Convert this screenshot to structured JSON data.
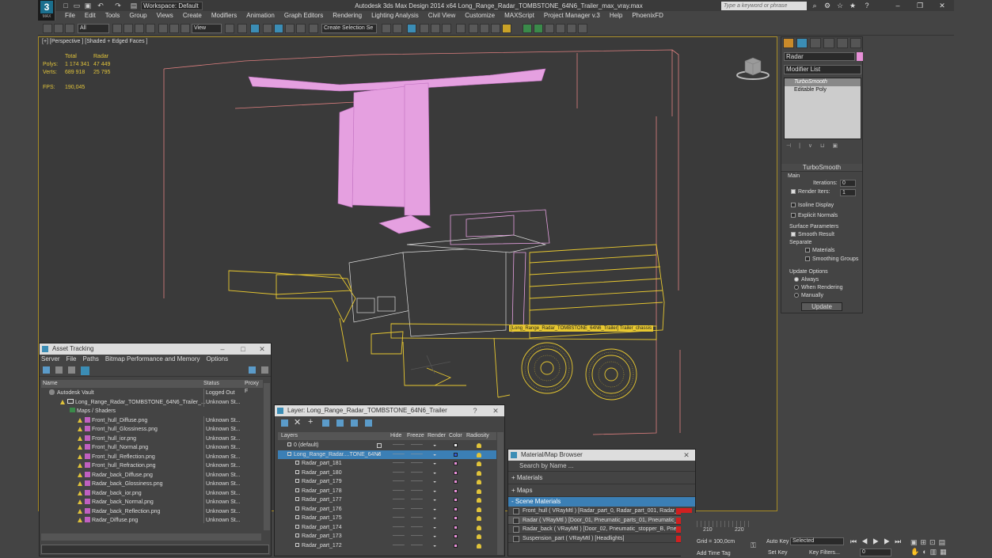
{
  "app": {
    "logo_letter": "3",
    "logo_sub": "MAX",
    "workspace": "Workspace: Default",
    "title": "Autodesk 3ds Max Design 2014 x64     Long_Range_Radar_TOMBSTONE_64N6_Trailer_max_vray.max",
    "search_placeholder": "Type a keyword or phrase"
  },
  "menus": [
    "File",
    "Edit",
    "Tools",
    "Group",
    "Views",
    "Create",
    "Modifiers",
    "Animation",
    "Graph Editors",
    "Rendering",
    "Lighting Analysis",
    "Civil View",
    "Customize",
    "MAXScript",
    "Project Manager v.3",
    "Help",
    "PhoenixFD"
  ],
  "toolbar": {
    "selection_filter": "All",
    "ref_coord": "View",
    "named_sel": "Create Selection Se"
  },
  "viewport": {
    "label": "[+] [Perspective ] [Shaded + Edged Faces ]",
    "stats": {
      "col1": "Total",
      "col2": "Radar",
      "polys_label": "Polys:",
      "polys_total": "1 174 341",
      "polys_radar": "47 449",
      "verts_label": "Verts:",
      "verts_total": "689 918",
      "verts_radar": "25 795",
      "fps_label": "FPS:",
      "fps_value": "190,045"
    },
    "tooltip": "[Long_Range_Radar_TOMBSTONE_64N6_Trailer] Trailer_chassis"
  },
  "command_panel": {
    "object_name": "Radar",
    "object_color": "#e890d8",
    "modifier_list": "Modifier List",
    "stack": [
      "TurboSmooth",
      "Editable Poly"
    ],
    "turbosmooth": {
      "title": "TurboSmooth",
      "main": "Main",
      "iterations_label": "Iterations:",
      "iterations": "0",
      "render_iters_label": "Render Iters:",
      "render_iters": "1",
      "isoline": "Isoline Display",
      "explicit": "Explicit Normals",
      "surface": "Surface Parameters",
      "smooth_result": "Smooth Result",
      "separate": "Separate",
      "materials": "Materials",
      "smoothing_groups": "Smoothing Groups",
      "update_options": "Update Options",
      "always": "Always",
      "when_rendering": "When Rendering",
      "manually": "Manually",
      "update_button": "Update"
    }
  },
  "asset_tracking": {
    "title": "Asset Tracking",
    "menus": [
      "Server",
      "File",
      "Paths",
      "Bitmap Performance and Memory",
      "Options"
    ],
    "columns": [
      "Name",
      "Status",
      "Proxy F"
    ],
    "rows": [
      {
        "name": "Autodesk Vault",
        "status": "Logged Out",
        "indent": 0
      },
      {
        "name": "Long_Range_Radar_TOMBSTONE_64N6_Trailer_...",
        "status": "Unknown St...",
        "indent": 1
      },
      {
        "name": "Maps / Shaders",
        "status": "",
        "indent": 2
      },
      {
        "name": "Front_hull_Diffuse.png",
        "status": "Unknown St...",
        "indent": 3
      },
      {
        "name": "Front_hull_Glossiness.png",
        "status": "Unknown St...",
        "indent": 3
      },
      {
        "name": "Front_hull_ior.png",
        "status": "Unknown St...",
        "indent": 3
      },
      {
        "name": "Front_hull_Normal.png",
        "status": "Unknown St...",
        "indent": 3
      },
      {
        "name": "Front_hull_Reflection.png",
        "status": "Unknown St...",
        "indent": 3
      },
      {
        "name": "Front_hull_Refraction.png",
        "status": "Unknown St...",
        "indent": 3
      },
      {
        "name": "Radar_back_Diffuse.png",
        "status": "Unknown St...",
        "indent": 3
      },
      {
        "name": "Radar_back_Glossiness.png",
        "status": "Unknown St...",
        "indent": 3
      },
      {
        "name": "Radar_back_ior.png",
        "status": "Unknown St...",
        "indent": 3
      },
      {
        "name": "Radar_back_Normal.png",
        "status": "Unknown St...",
        "indent": 3
      },
      {
        "name": "Radar_back_Reflection.png",
        "status": "Unknown St...",
        "indent": 3
      },
      {
        "name": "Radar_Diffuse.png",
        "status": "Unknown St...",
        "indent": 3
      }
    ]
  },
  "layers": {
    "title": "Layer: Long_Range_Radar_TOMBSTONE_64N6_Trailer",
    "columns": [
      "Layers",
      "Hide",
      "Freeze",
      "Render",
      "Color",
      "Radiosity"
    ],
    "rows": [
      "0 (default)",
      "Long_Range_Radar....TONE_64N6",
      "Radar_part_181",
      "Radar_part_180",
      "Radar_part_179",
      "Radar_part_178",
      "Radar_part_177",
      "Radar_part_176",
      "Radar_part_175",
      "Radar_part_174",
      "Radar_part_173",
      "Radar_part_172"
    ]
  },
  "material_browser": {
    "title": "Material/Map Browser",
    "search_placeholder": "Search by Name ...",
    "groups": [
      "+ Materials",
      "+ Maps",
      "- Scene Materials"
    ],
    "materials": [
      "Front_hull ( VRayMtl ) [Radar_part_0, Radar_part_001, Radar_p...",
      "Radar ( VRayMtl ) [Door_01, Pneumatic_parts_01, Pneumatic_p...",
      "Radar_back ( VRayMtl ) [Door_02, Pneumatic_stopper_B, Pneu...",
      "Suspension_part ( VRayMtl ) [Headlights]"
    ]
  },
  "status": {
    "grid": "Grid = 100,0cm",
    "auto_key": "Auto Key",
    "selected": "Selected",
    "set_key": "Set Key",
    "key_filters": "Key Filters...",
    "add_time_tag": "Add Time Tag",
    "frame": "0",
    "tick1": "210",
    "tick2": "220"
  }
}
